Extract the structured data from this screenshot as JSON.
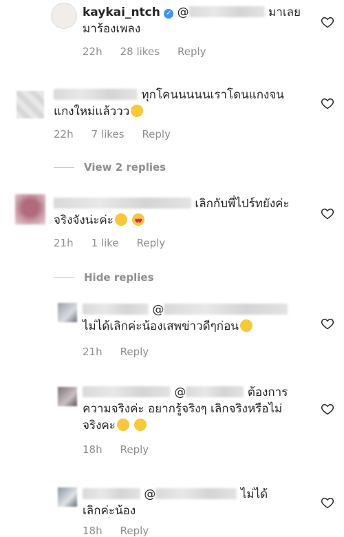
{
  "comments": [
    {
      "username": "kaykai_ntch",
      "mention": "@",
      "text_lines": [
        "มาเลย",
        "มาร้องเพลง"
      ],
      "time": "22h",
      "likes": "28 likes",
      "reply": "Reply"
    },
    {
      "text_lines": [
        "ทุกโคนนนนนเราโดนแกงจน",
        "แกงใหม่แล้ววว"
      ],
      "time": "22h",
      "likes": "7 likes",
      "reply": "Reply",
      "thread": "View 2 replies"
    },
    {
      "text_lines": [
        "เลิกกับพี่ไปร์ทยังค่ะ",
        "จริงจังน่ะค่ะ"
      ],
      "time": "21h",
      "likes": "1 like",
      "reply": "Reply",
      "thread": "Hide replies"
    },
    {
      "mention": "@",
      "text_lines": [
        "ไม่ได้เลิกค่ะน้องเสพข่าวดีๆก่อน"
      ],
      "time": "21h",
      "reply": "Reply"
    },
    {
      "mention": "@",
      "text_lines": [
        "ต้องการ",
        "ความจริงค่ะ อยากรู้จริงๆ เลิกจริงหรือไม่",
        "จริงคะ"
      ],
      "time": "18h",
      "reply": "Reply"
    },
    {
      "mention": "@",
      "text_lines": [
        "ไม่ได้",
        "เลิกค่ะน้อง"
      ],
      "time": "18h",
      "reply": "Reply"
    }
  ],
  "icons": {
    "like": "heart-outline-icon",
    "verified": "verified-badge-icon"
  }
}
